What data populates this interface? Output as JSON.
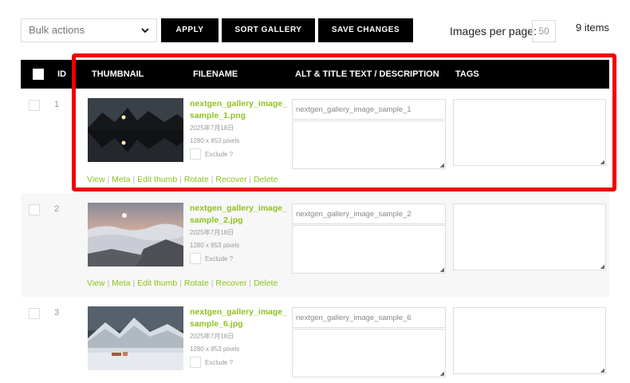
{
  "toolbar": {
    "bulk_actions": "Bulk actions",
    "apply_label": "APPLY",
    "sort_gallery_label": "SORT GALLERY",
    "save_changes_label": "SAVE CHANGES",
    "images_per_page_label": "Images per page:",
    "images_per_page_value": "50",
    "items_count": "9 items"
  },
  "table": {
    "columns": {
      "id": "ID",
      "thumbnail": "THUMBNAIL",
      "filename": "FILENAME",
      "alt_title": "ALT & TITLE TEXT / DESCRIPTION",
      "tags": "TAGS"
    },
    "rows": [
      {
        "id": "1",
        "filename": "nextgen_gallery_image_sample_1.png",
        "date": "2025年7月18日",
        "dimensions": "1280 x 853 pixels",
        "exclude_label": "Exclude ?",
        "alt_text": "nextgen_gallery_image_sample_1",
        "description": "",
        "tags": ""
      },
      {
        "id": "2",
        "filename": "nextgen_gallery_image_sample_2.jpg",
        "date": "2025年7月18日",
        "dimensions": "1280 x 853 pixels",
        "exclude_label": "Exclude ?",
        "alt_text": "nextgen_gallery_image_sample_2",
        "description": "",
        "tags": ""
      },
      {
        "id": "3",
        "filename": "nextgen_gallery_image_sample_6.jpg",
        "date": "2025年7月18日",
        "dimensions": "1280 x 853 pixels",
        "exclude_label": "Exclude ?",
        "alt_text": "nextgen_gallery_image_sample_6",
        "description": "",
        "tags": ""
      }
    ],
    "row_actions": {
      "view": "View",
      "meta": "Meta",
      "edit_thumb": "Edit thumb",
      "rotate": "Rotate",
      "recover": "Recover",
      "delete": "Delete",
      "separator": "|"
    }
  },
  "colors": {
    "accent_green": "#8dc21f",
    "highlight_red": "#ee0000",
    "header_black": "#000000"
  },
  "icons": {
    "dropdown": "chevron-down-icon",
    "resize": "resize-grip-icon"
  }
}
